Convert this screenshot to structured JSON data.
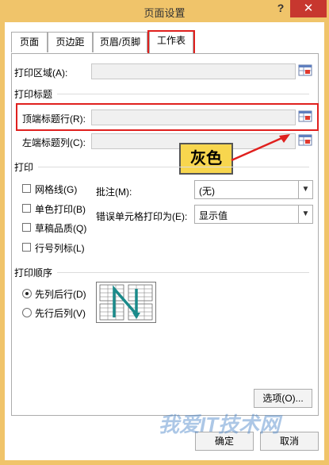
{
  "dialog": {
    "title": "页面设置",
    "help": "?",
    "close": "✕"
  },
  "tabs": [
    {
      "label": "页面"
    },
    {
      "label": "页边距"
    },
    {
      "label": "页眉/页脚"
    },
    {
      "label": "工作表"
    }
  ],
  "print_area": {
    "label": "打印区域(A):",
    "value": ""
  },
  "print_titles": {
    "heading": "打印标题",
    "top_rows_label": "顶端标题行(R):",
    "top_rows_value": "",
    "left_cols_label": "左端标题列(C):",
    "left_cols_value": ""
  },
  "callout": {
    "text": "灰色"
  },
  "print": {
    "heading": "打印",
    "gridlines": {
      "label": "网格线(G)",
      "checked": false
    },
    "mono": {
      "label": "单色打印(B)",
      "checked": false
    },
    "draft": {
      "label": "草稿品质(Q)",
      "checked": false
    },
    "rowcol": {
      "label": "行号列标(L)",
      "checked": false
    },
    "comments_label": "批注(M):",
    "comments_value": "(无)",
    "errors_label": "错误单元格打印为(E):",
    "errors_value": "显示值"
  },
  "order": {
    "heading": "打印顺序",
    "down_then_over": {
      "label": "先列后行(D)",
      "selected": true
    },
    "over_then_down": {
      "label": "先行后列(V)",
      "selected": false
    }
  },
  "buttons": {
    "options": "选项(O)...",
    "ok": "确定",
    "cancel": "取消"
  },
  "watermark": "我爱IT技术网",
  "colors": {
    "frame": "#f0c46a",
    "highlight": "#e0201e",
    "callout": "#f8d64e",
    "close": "#c7372f"
  }
}
